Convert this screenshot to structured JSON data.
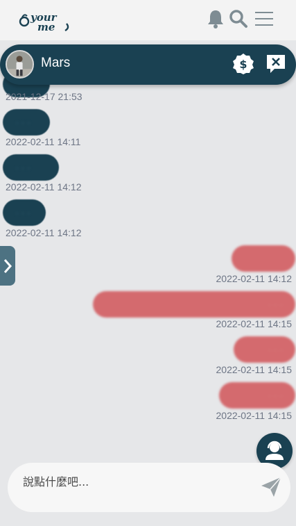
{
  "app": {
    "logo_text": "Your Me",
    "icons": [
      "bell-icon",
      "search-icon",
      "hamburger-menu-icon"
    ]
  },
  "chat": {
    "contact_name": "Mars",
    "header_icons": [
      "dollar-badge-icon",
      "close-chat-icon"
    ]
  },
  "messages": [
    {
      "side": "left",
      "timestamp": "2021-12-17 21:53",
      "text_blurred": true
    },
    {
      "side": "left",
      "timestamp": "2022-02-11 14:11",
      "text_blurred": true
    },
    {
      "side": "left",
      "timestamp": "2022-02-11 14:12",
      "text_blurred": true
    },
    {
      "side": "left",
      "timestamp": "2022-02-11 14:12",
      "text_blurred": true
    },
    {
      "side": "right",
      "timestamp": "2022-02-11 14:12",
      "text_blurred": true
    },
    {
      "side": "right",
      "timestamp": "2022-02-11 14:15",
      "text_blurred": true
    },
    {
      "side": "right",
      "timestamp": "2022-02-11 14:15",
      "text_blurred": true
    },
    {
      "side": "right",
      "timestamp": "2022-02-11 14:15",
      "text_blurred": true
    }
  ],
  "composer": {
    "placeholder": "說點什麼吧..."
  },
  "colors": {
    "brand_dark": "#1a4152",
    "outgoing_bubble": "#d46a6e",
    "background": "#e6e7e9",
    "timestamp": "#6d7585"
  }
}
